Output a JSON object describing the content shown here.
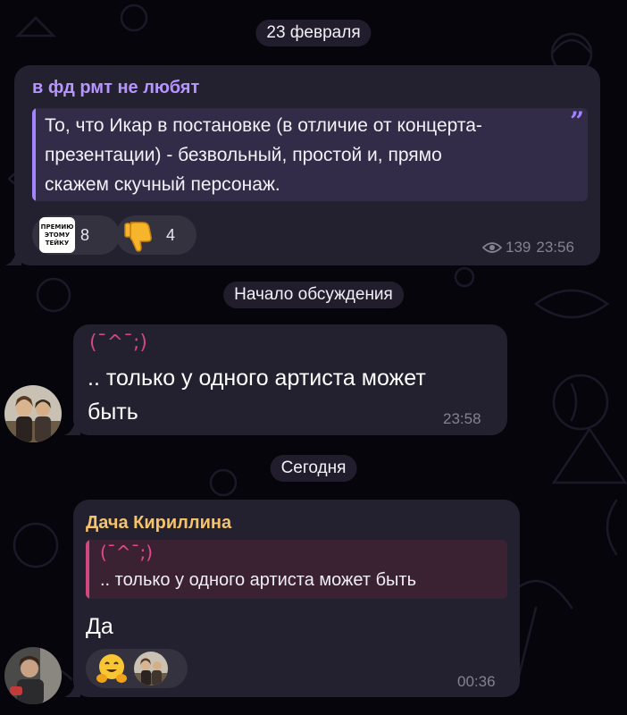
{
  "chat": {
    "date_separator_1": "23 февраля",
    "post": {
      "channel_name": "в фд рмт не любят",
      "quote_text": "То, что Икар в постановке (в отличие от концерта-презентации) - безвольный, простой и, прямо скажем скучный персонаж.",
      "quote_line_1": "То, что Икар в постановке (в отличие от концерта-",
      "quote_line_2": "презентации) - безвольный, простой и, прямо",
      "quote_line_3": "скажем скучный персонаж.",
      "reactions": [
        {
          "sticker_text_1": "ПРЕМИЮ",
          "sticker_text_2": "ЭТОМУ",
          "sticker_text_3": "ТЕЙКУ",
          "count": "8",
          "icon": "premium-sticker-icon"
        },
        {
          "icon": "thumbs-down-icon",
          "count": "4"
        }
      ],
      "views": "139",
      "time": "23:56"
    },
    "discussion_separator": "Начало обсуждения",
    "message_1": {
      "emoticon": "(¯^¯;)",
      "line_1": ".. только у одного артиста может",
      "line_2": "быть",
      "time": "23:58"
    },
    "date_separator_2": "Сегодня",
    "message_2": {
      "sender": "Дача Кириллина",
      "reply_emoticon": "(¯^¯;)",
      "reply_text": ".. только у одного артиста может быть",
      "text": "Да",
      "reactions": [
        {
          "icon": "hugging-face-icon"
        },
        {
          "icon": "avatar-reaction-icon"
        }
      ],
      "time": "00:36"
    }
  },
  "colors": {
    "background": "#07050c",
    "bubble": "#23212f",
    "channel_accent": "#b795ff",
    "sender_accent": "#f6c36a",
    "reply_accent": "#d0487f"
  }
}
